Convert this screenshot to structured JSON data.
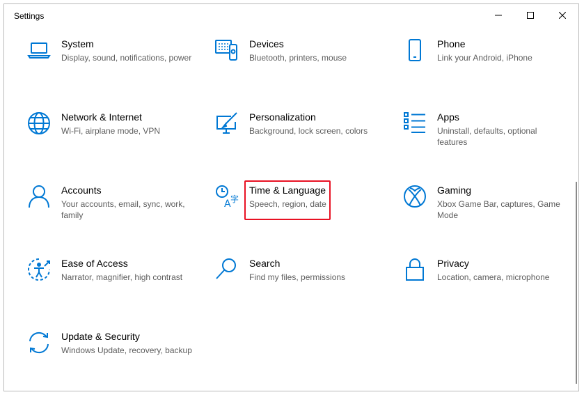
{
  "window": {
    "title": "Settings",
    "controls": {
      "minimize": "minimize",
      "maximize": "maximize",
      "close": "close"
    }
  },
  "categories": [
    {
      "name": "System",
      "desc": "Display, sound, notifications, power",
      "icon": "laptop-icon"
    },
    {
      "name": "Devices",
      "desc": "Bluetooth, printers, mouse",
      "icon": "devices-icon"
    },
    {
      "name": "Phone",
      "desc": "Link your Android, iPhone",
      "icon": "phone-icon"
    },
    {
      "name": "Network & Internet",
      "desc": "Wi-Fi, airplane mode, VPN",
      "icon": "globe-icon"
    },
    {
      "name": "Personalization",
      "desc": "Background, lock screen, colors",
      "icon": "paint-brush-icon"
    },
    {
      "name": "Apps",
      "desc": "Uninstall, defaults, optional features",
      "icon": "apps-list-icon"
    },
    {
      "name": "Accounts",
      "desc": "Your accounts, email, sync, work, family",
      "icon": "person-icon"
    },
    {
      "name": "Time & Language",
      "desc": "Speech, region, date",
      "icon": "time-language-icon",
      "highlighted": true
    },
    {
      "name": "Gaming",
      "desc": "Xbox Game Bar, captures, Game Mode",
      "icon": "xbox-icon"
    },
    {
      "name": "Ease of Access",
      "desc": "Narrator, magnifier, high contrast",
      "icon": "ease-of-access-icon"
    },
    {
      "name": "Search",
      "desc": "Find my files, permissions",
      "icon": "search-icon"
    },
    {
      "name": "Privacy",
      "desc": "Location, camera, microphone",
      "icon": "lock-icon"
    },
    {
      "name": "Update & Security",
      "desc": "Windows Update, recovery, backup",
      "icon": "sync-icon"
    }
  ],
  "colors": {
    "accent": "#0078d4",
    "highlight_border": "#e81123",
    "desc_text": "#5d5d5d"
  }
}
